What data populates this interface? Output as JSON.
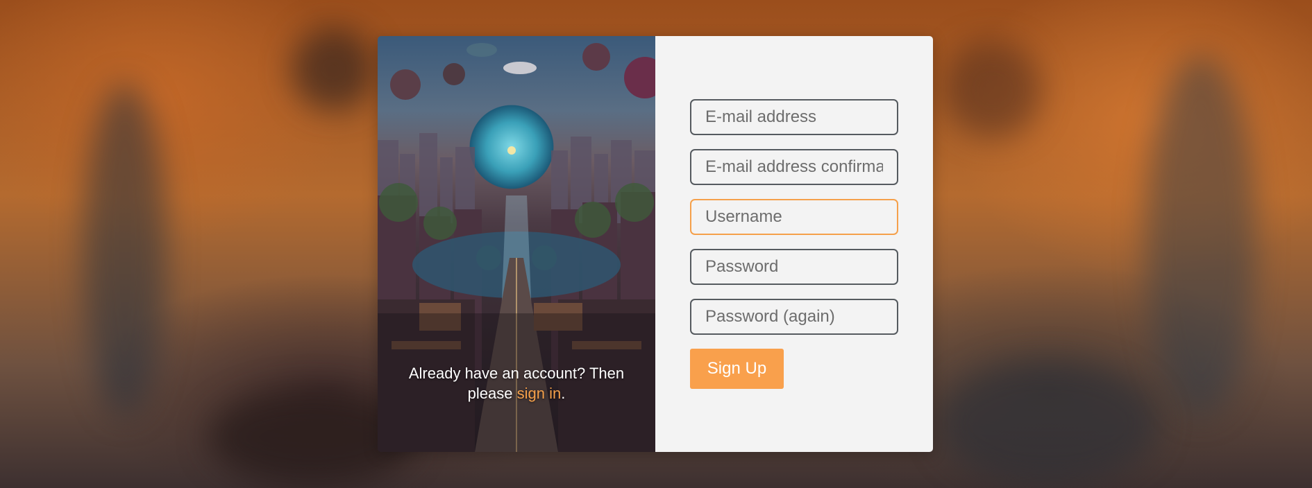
{
  "art": {
    "caption_prefix": "Already have an account? Then please ",
    "signin_link": "sign in",
    "caption_suffix": "."
  },
  "form": {
    "email_placeholder": "E-mail address",
    "email_confirm_placeholder": "E-mail address confirmation",
    "username_placeholder": "Username",
    "password_placeholder": "Password",
    "password_again_placeholder": "Password (again)",
    "submit_label": "Sign Up"
  },
  "colors": {
    "accent": "#f9a04c",
    "panel_bg": "#f3f3f3",
    "input_border": "#555a5f"
  }
}
